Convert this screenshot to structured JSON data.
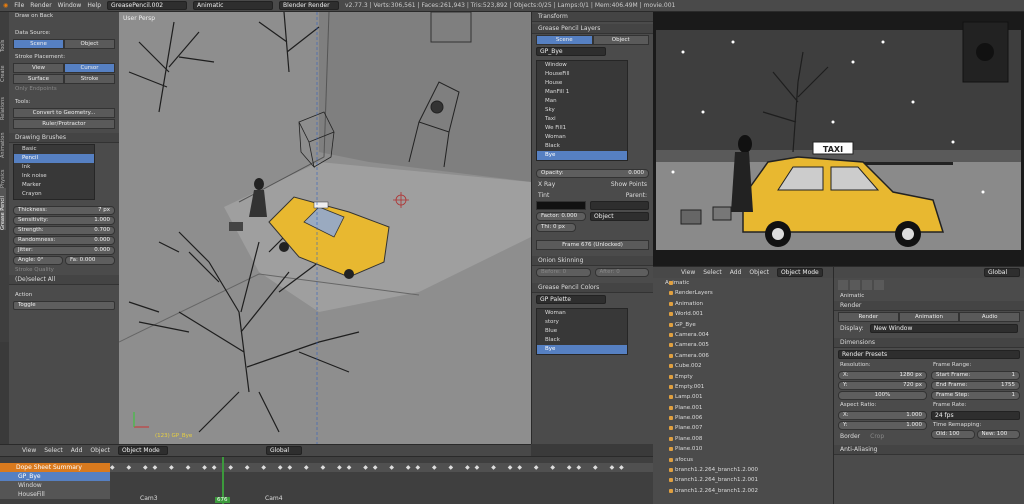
{
  "topbar": {
    "menus": [
      "File",
      "Render",
      "Window",
      "Help"
    ],
    "scene_name": "GreasePencil.002",
    "layout_name": "Animatic",
    "engine": "Blender Render",
    "stats": "v2.77.3 | Verts:306,561 | Faces:261,943 | Tris:523,892 | Objects:0/25 | Lamps:0/1 | Mem:406.49M | movie.001"
  },
  "toolshelf": {
    "draw_on_back": "Draw on Back",
    "data_source_label": "Data Source:",
    "data_source": [
      "Scene",
      "Object"
    ],
    "stroke_placement_label": "Stroke Placement:",
    "placement_row1": [
      "View",
      "Cursor"
    ],
    "placement_row2": [
      "Surface",
      "Stroke"
    ],
    "only_endpoints": "Only Endpoints",
    "tools_label": "Tools:",
    "convert": "Convert to Geometry...",
    "ruler": "Ruler/Protractor",
    "drawing_brushes": "Drawing Brushes",
    "brushes": [
      "Basic",
      "Pencil",
      "Ink",
      "Ink noise",
      "Marker",
      "Crayon"
    ],
    "thickness_label": "Thickness:",
    "thickness": "7 px",
    "sensitivity_label": "Sensitivity:",
    "sensitivity": "1.000",
    "strength_label": "Strength:",
    "strength": "0.700",
    "randomness_label": "Randomness:",
    "randomness": "0.000",
    "jitter_label": "Jitter:",
    "jitter": "0.000",
    "angle": "Angle: 0°",
    "fa": "Fa: 0.000",
    "stroke_quality": "Stroke Quality",
    "deselect": "(De)select All",
    "action_label": "Action",
    "action": "Toggle",
    "tabs": [
      "Tools",
      "Create",
      "Relations",
      "Animation",
      "Physics",
      "Grease Pencil"
    ]
  },
  "viewport3d": {
    "label": "User Persp",
    "frame_label": "(123) GP_Bye",
    "menus": [
      "View",
      "Select",
      "Add",
      "Object"
    ],
    "mode": "Object Mode",
    "orientation": "Global"
  },
  "gp_panel": {
    "transform": "Transform",
    "title": "Grease Pencil Layers",
    "source": [
      "Scene",
      "Object"
    ],
    "datablock": "GP_Bye",
    "layers": [
      "Window",
      "HouseFill",
      "House",
      "ManFill 1",
      "Man",
      "Sky",
      "Taxi",
      "We Fill1",
      "Woman",
      "Black",
      "Bye"
    ],
    "opacity_label": "Opacity:",
    "opacity": "0.000",
    "xray": "X Ray",
    "show_points": "Show Points",
    "tint": "Tint",
    "parent": "Parent:",
    "factor": "Factor: 0.000",
    "thickness": "Thi: 0 px",
    "parent_type": "Object",
    "frame": "Frame 676 (Unlocked)",
    "onion": "Onion Skinning",
    "before": "Before: 0",
    "after": "After: 0",
    "colors_title": "Grease Pencil Colors",
    "palette": "GP Palette",
    "colors": [
      "Woman",
      "story",
      "Blue",
      "Black",
      "Bye"
    ]
  },
  "render_view": {
    "taxi_sign": "TAXI"
  },
  "outliner": {
    "menus": [
      "View",
      "Select",
      "Add",
      "Object"
    ],
    "mode": "Object Mode",
    "orientation": "Global",
    "root": "Animatic",
    "items": [
      "RenderLayers",
      "Animation",
      "World.001",
      "GP_Bye",
      "Camera.004",
      "Camera.005",
      "Camera.006",
      "Cube.002",
      "Empty",
      "Empty.001",
      "Lamp.001",
      "Plane.001",
      "Plane.006",
      "Plane.007",
      "Plane.008",
      "Plane.010",
      "afocus",
      "branch1.2.264_branch1.2.000",
      "branch1.2.264_branch1.2.001",
      "branch1.2.264_branch1.2.002"
    ]
  },
  "properties": {
    "scene": "Animatic",
    "render": "Render",
    "buttons": [
      "Render",
      "Animation",
      "Audio"
    ],
    "display_label": "Display:",
    "display": "New Window",
    "dimensions": "Dimensions",
    "presets": "Render Presets",
    "resolution": "Resolution:",
    "resx": "X:",
    "resx_val": "1280 px",
    "resy": "Y:",
    "resy_val": "720 px",
    "percent": "100%",
    "frame_range": "Frame Range:",
    "start_label": "Start Frame:",
    "start": "1",
    "end_label": "End Frame:",
    "end": "1755",
    "step_label": "Frame Step:",
    "step": "1",
    "aspect": "Aspect Ratio:",
    "ax": "X:",
    "ax_val": "1.000",
    "ay": "Y:",
    "ay_val": "1.000",
    "frame_rate": "Frame Rate:",
    "fps": "24 fps",
    "time_remap": "Time Remapping:",
    "old": "Old: 100",
    "new": "New: 100",
    "border": "Border",
    "crop": "Crop",
    "aa": "Anti-Aliasing"
  },
  "dopesheet": {
    "summary": "Dope Sheet Summary",
    "rows": [
      "GP_Bye",
      "Window",
      "HouseFill"
    ],
    "markers": [
      "Cam3",
      "Cam4"
    ],
    "current_frame": "676"
  },
  "colors": {
    "accent": "#5680c2",
    "taxi": "#e8b830",
    "summary": "#d97a1e"
  }
}
